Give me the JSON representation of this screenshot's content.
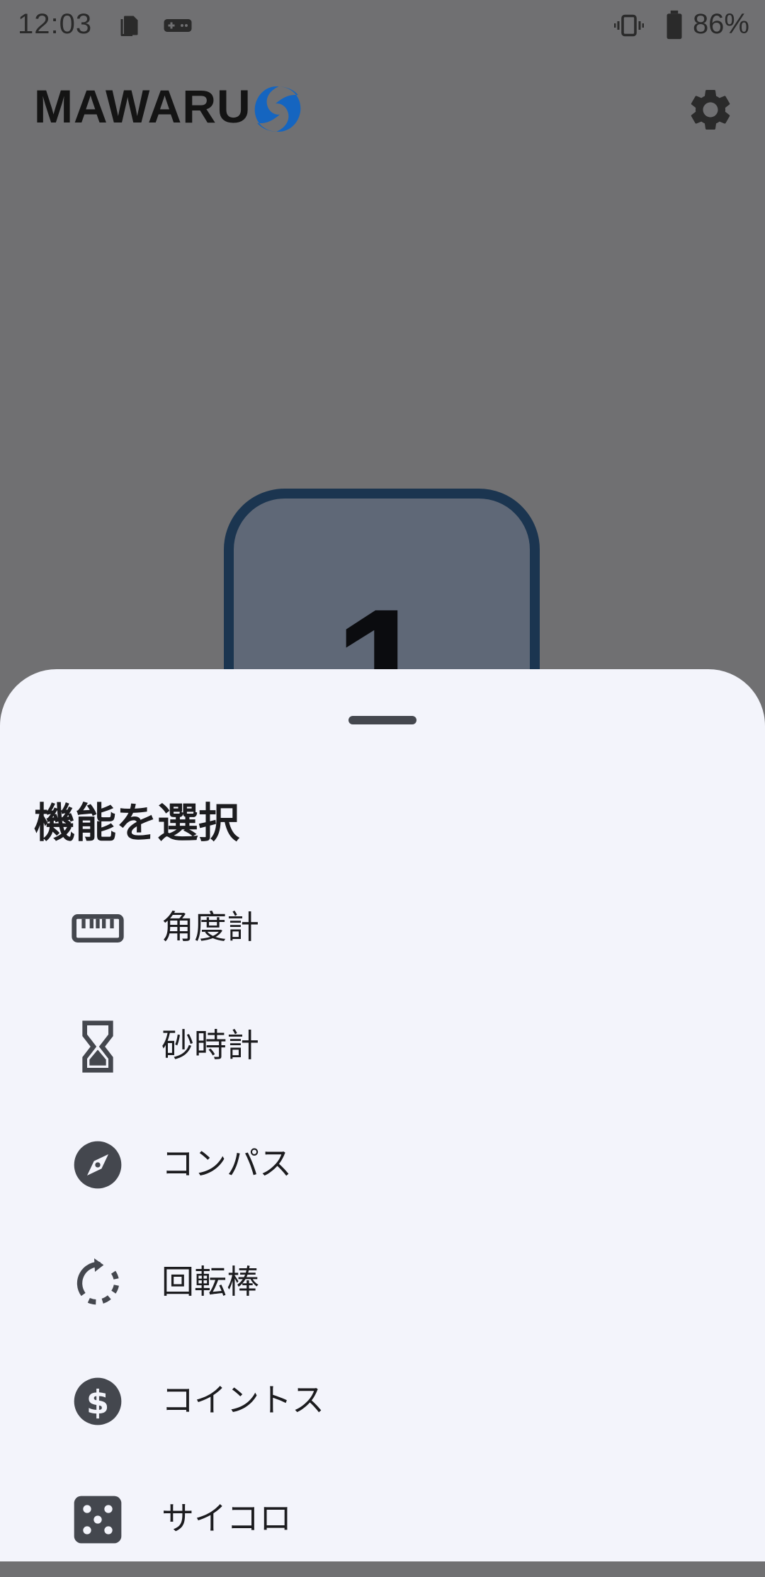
{
  "status_bar": {
    "time": "12:03",
    "battery_percent": "86%",
    "icons": [
      "sim-card-icon",
      "gamepad-icon",
      "vibrate-icon",
      "battery-icon"
    ]
  },
  "app_bar": {
    "title": "MAWARU",
    "logo_icon": "cyclone-logo-icon",
    "logo_color": "#1565c0",
    "settings_icon": "gear-icon"
  },
  "counter": {
    "value": "1",
    "border_color": "#1b3550"
  },
  "sheet": {
    "title": "機能を選択",
    "items": [
      {
        "label": "角度計",
        "icon": "ruler-icon"
      },
      {
        "label": "砂時計",
        "icon": "hourglass-icon"
      },
      {
        "label": "コンパス",
        "icon": "compass-icon"
      },
      {
        "label": "回転棒",
        "icon": "rotate-icon"
      },
      {
        "label": "コイントス",
        "icon": "dollar-coin-icon"
      },
      {
        "label": "サイコロ",
        "icon": "dice-icon"
      }
    ]
  }
}
